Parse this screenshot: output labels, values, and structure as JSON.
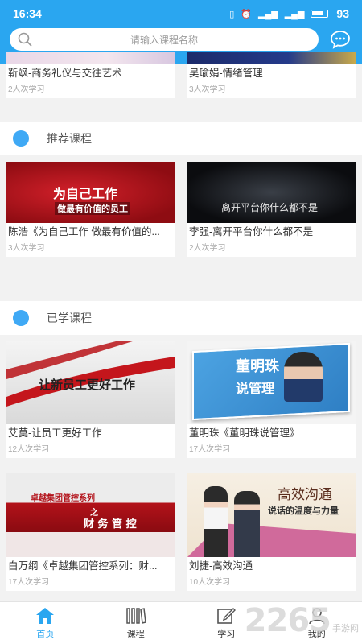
{
  "status_bar": {
    "time": "16:34",
    "battery": "93"
  },
  "search": {
    "placeholder": "请输入课程名称"
  },
  "top_row": [
    {
      "title": "靳飒-商务礼仪与交往艺术",
      "count": "2人次学习"
    },
    {
      "title": "吴瑜娟-情绪管理",
      "count": "3人次学习"
    }
  ],
  "recommended": {
    "heading": "推荐课程",
    "courses": [
      {
        "title": "陈浩《为自己工作  做最有价值的...",
        "count": "3人次学习",
        "thumb_line1": "为自己工作",
        "thumb_line2": "做最有价值的员工"
      },
      {
        "title": "李强-离开平台你什么都不是",
        "count": "2人次学习",
        "thumb_line1": "离开平台你什么都不是"
      }
    ]
  },
  "learned": {
    "heading": "已学课程",
    "courses": [
      {
        "title": "艾莫-让员工更好工作",
        "count": "12人次学习",
        "thumb_line1": "让新员工更好工作"
      },
      {
        "title": "董明珠《董明珠说管理》",
        "count": "17人次学习",
        "thumb_line1": "董明珠",
        "thumb_line2": "说管理"
      },
      {
        "title": "白万纲《卓越集团管控系列：财...",
        "count": "17人次学习",
        "thumb_line1": "卓越集团管控系列",
        "thumb_line2": "之",
        "thumb_line3": "财 务 管 控"
      },
      {
        "title": "刘捷-高效沟通",
        "count": "10人次学习",
        "thumb_line1": "高效沟通",
        "thumb_line2": "说话的温度与力量"
      }
    ]
  },
  "tabbar": {
    "items": [
      {
        "label": "首页",
        "active": true
      },
      {
        "label": "课程",
        "active": false
      },
      {
        "label": "学习",
        "active": false
      },
      {
        "label": "我的",
        "active": false
      }
    ]
  },
  "watermark": {
    "number": "2265",
    "text": "手游网"
  },
  "colors": {
    "brand": "#2aa6f0",
    "section_dot": "#3fa9f5"
  }
}
